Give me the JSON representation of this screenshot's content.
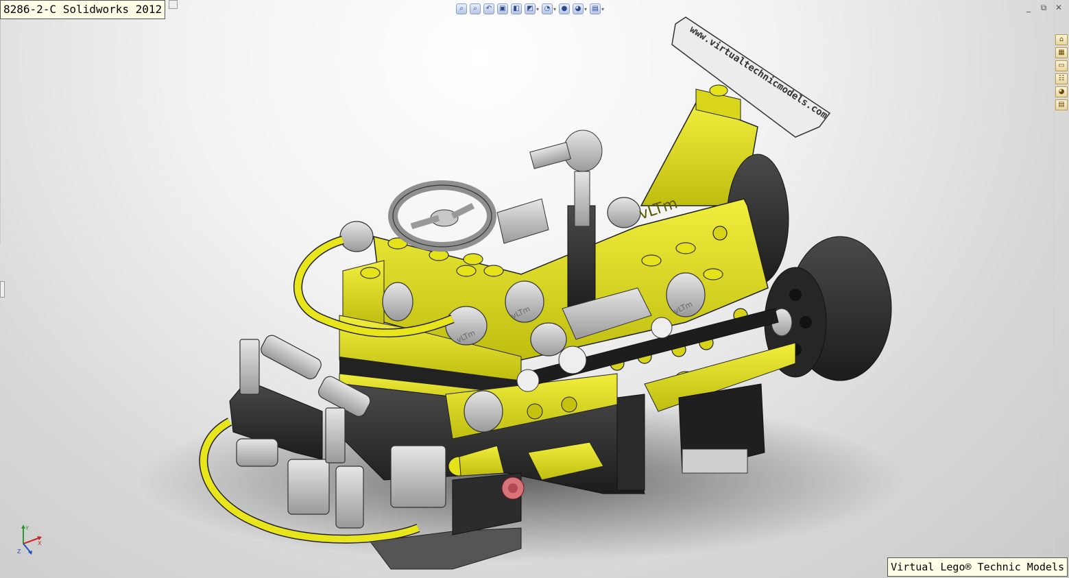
{
  "window": {
    "title": "8286-2-C Solidworks 2012",
    "watermark": "Virtual Lego® Technic Models",
    "controls": [
      "_",
      "⧉",
      "✕"
    ]
  },
  "heads_up_toolbar": [
    {
      "icon": "zoom-to-fit-icon",
      "glyph": "⌕"
    },
    {
      "icon": "zoom-to-area-icon",
      "glyph": "⌕"
    },
    {
      "icon": "previous-view-icon",
      "glyph": "↶"
    },
    {
      "icon": "section-view-icon",
      "glyph": "▣"
    },
    {
      "icon": "view-orientation-icon",
      "glyph": "◧"
    },
    {
      "icon": "display-style-icon",
      "glyph": "◩"
    },
    {
      "icon": "hide-show-items-icon",
      "glyph": "◔"
    },
    {
      "icon": "edit-appearance-icon",
      "glyph": "●"
    },
    {
      "icon": "apply-scene-icon",
      "glyph": "◕"
    },
    {
      "icon": "view-settings-icon",
      "glyph": "▤"
    }
  ],
  "task_pane": [
    {
      "icon": "solidworks-resources-icon",
      "glyph": "⌂"
    },
    {
      "icon": "design-library-icon",
      "glyph": "▦"
    },
    {
      "icon": "file-explorer-icon",
      "glyph": "▭"
    },
    {
      "icon": "view-palette-icon",
      "glyph": "☷"
    },
    {
      "icon": "appearances-scenes-icon",
      "glyph": "◕"
    },
    {
      "icon": "custom-properties-icon",
      "glyph": "▤"
    }
  ],
  "model": {
    "plate_text": "www.virtualtechnicmodels.com",
    "beam_text": "vLTm",
    "colors": {
      "yellow": "#e5e21a",
      "black": "#2a2a2a",
      "gray": "#b9b9b9",
      "red": "#d9737a"
    }
  },
  "triad": {
    "x": "X",
    "y": "Y",
    "z": "Z"
  }
}
